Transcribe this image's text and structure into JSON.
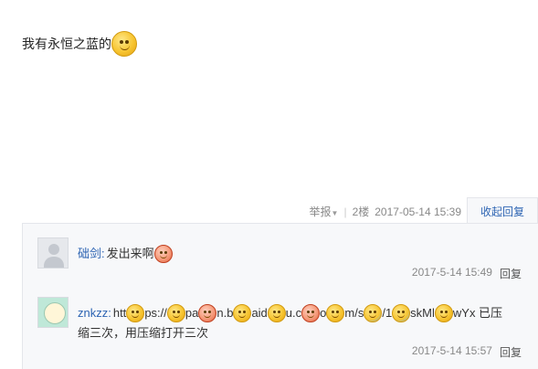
{
  "post": {
    "text": "我有永恒之蓝的"
  },
  "meta": {
    "report": "举报",
    "floor": "2楼",
    "time": "2017-05-14 15:39",
    "collapse": "收起回复"
  },
  "replies": [
    {
      "user": "础剑:",
      "text": "发出来啊",
      "time": "2017-5-14 15:49",
      "reply": "回复"
    },
    {
      "user": "znkzz:",
      "segments": [
        "htt",
        "ps://",
        "pa",
        "n.b",
        "aid",
        "u.c",
        "o",
        "m/s",
        "/1",
        "skMl",
        "wYx 已压"
      ],
      "line2": "缩三次，用压缩打开三次",
      "time": "2017-5-14 15:57",
      "reply": "回复"
    }
  ]
}
